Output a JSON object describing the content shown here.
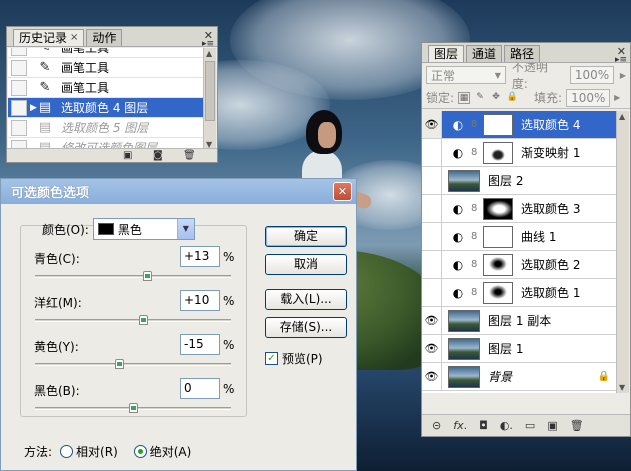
{
  "history_panel": {
    "tabs": [
      {
        "label": "历史记录",
        "active": true
      },
      {
        "label": "动作",
        "active": false
      }
    ],
    "items": [
      {
        "label": "画笔工具",
        "icon": "brush-icon",
        "state": "partial"
      },
      {
        "label": "画笔工具",
        "icon": "brush-icon",
        "state": "normal"
      },
      {
        "label": "画笔工具",
        "icon": "brush-icon",
        "state": "normal"
      },
      {
        "label": "选取颜色 4 图层",
        "icon": "document-icon",
        "state": "selected"
      },
      {
        "label": "选取颜色 5 图层",
        "icon": "document-icon",
        "state": "dim"
      },
      {
        "label": "修改可选颜色图层",
        "icon": "document-icon",
        "state": "dim"
      }
    ]
  },
  "layers_panel": {
    "tabs": [
      {
        "label": "图层",
        "active": true
      },
      {
        "label": "通道",
        "active": false
      },
      {
        "label": "路径",
        "active": false
      }
    ],
    "blend_mode": "正常",
    "opacity_label": "不透明度:",
    "opacity_value": "100%",
    "lock_label": "锁定:",
    "fill_label": "填充:",
    "fill_value": "100%",
    "layers": [
      {
        "name": "选取颜色 4",
        "visible": true,
        "type": "adjustment",
        "mask": "white",
        "selected": true
      },
      {
        "name": "渐变映射 1",
        "visible": false,
        "type": "adjustment",
        "mask": "figure"
      },
      {
        "name": "图层 2",
        "visible": false,
        "type": "photo"
      },
      {
        "name": "选取颜色 3",
        "visible": false,
        "type": "adjustment",
        "mask": "dark"
      },
      {
        "name": "曲线 1",
        "visible": false,
        "type": "adjustment",
        "mask": "white"
      },
      {
        "name": "选取颜色 2",
        "visible": false,
        "type": "adjustment",
        "mask": "light"
      },
      {
        "name": "选取颜色 1",
        "visible": false,
        "type": "adjustment",
        "mask": "light"
      },
      {
        "name": "图层 1 副本",
        "visible": true,
        "type": "photo"
      },
      {
        "name": "图层 1",
        "visible": true,
        "type": "photo"
      },
      {
        "name": "背景",
        "visible": true,
        "type": "photo",
        "locked": true
      }
    ]
  },
  "dialog": {
    "title": "可选颜色选项",
    "color_label": "颜色(O):",
    "color_value": "黑色",
    "sliders": [
      {
        "label": "青色(C):",
        "value": "+13",
        "fraction": 0.57
      },
      {
        "label": "洋红(M):",
        "value": "+10",
        "fraction": 0.55
      },
      {
        "label": "黄色(Y):",
        "value": "-15",
        "fraction": 0.43
      },
      {
        "label": "黑色(B):",
        "value": "0",
        "fraction": 0.5
      }
    ],
    "percent": "%",
    "buttons": {
      "ok": "确定",
      "cancel": "取消",
      "load": "载入(L)...",
      "save": "存储(S)..."
    },
    "preview_label": "预览(P)",
    "preview_checked": true,
    "method_label": "方法:",
    "method_options": [
      {
        "label": "相对(R)",
        "selected": false
      },
      {
        "label": "绝对(A)",
        "selected": true
      }
    ]
  }
}
